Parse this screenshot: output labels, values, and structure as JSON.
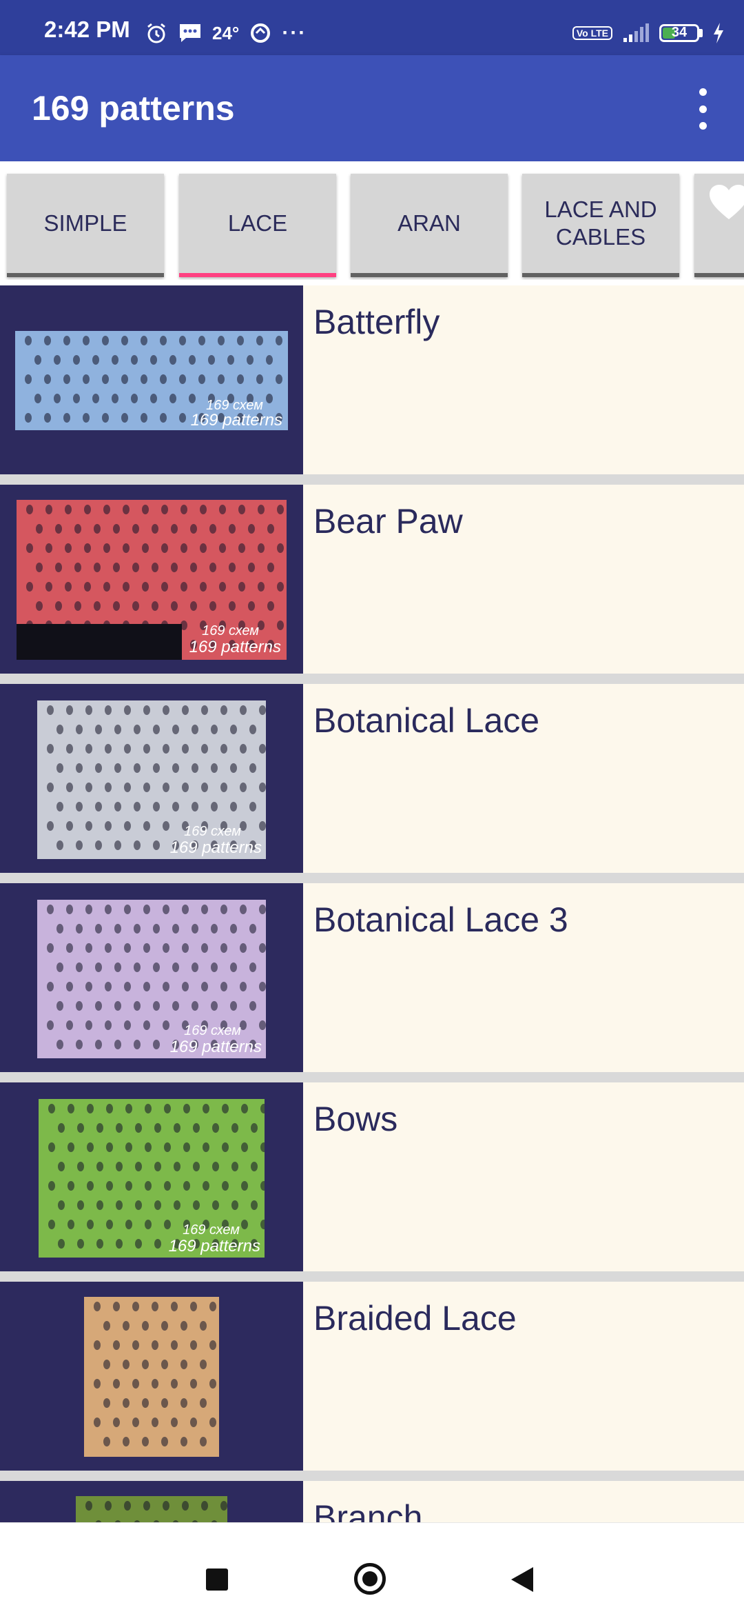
{
  "status_bar": {
    "time": "2:42 PM",
    "temperature": "24°",
    "more": "···",
    "network": "Vo LTE",
    "battery": "34"
  },
  "app_bar": {
    "title": "169 patterns",
    "overflow_icon": "more-vert-icon"
  },
  "tabs": [
    {
      "label": "SIMPLE",
      "active": false
    },
    {
      "label": "LACE",
      "active": true
    },
    {
      "label": "ARAN",
      "active": false
    },
    {
      "label": "LACE AND CABLES",
      "active": false
    },
    {
      "label": "",
      "icon": "heart-icon",
      "active": false
    }
  ],
  "patterns": [
    {
      "name": "Batterfly",
      "color": "#8fb2de"
    },
    {
      "name": "Bear Paw",
      "color": "#d5575f"
    },
    {
      "name": "Botanical Lace",
      "color": "#c9ccd6"
    },
    {
      "name": "Botanical Lace 3",
      "color": "#c8b3dc"
    },
    {
      "name": "Bows",
      "color": "#7db94a"
    },
    {
      "name": "Braided Lace",
      "color": "#d6a878"
    },
    {
      "name": "Branch",
      "color": "#6f8f3a"
    }
  ],
  "watermark": {
    "line1": "169 схем",
    "line2": "169 patterns"
  },
  "colors": {
    "status_bar": "#2f3f9b",
    "app_bar": "#3d51b7",
    "tab_indicator": "#ff4081",
    "list_bg": "#fdf8ec",
    "thumb_bg": "#2d2a5e",
    "text": "#2a2a5c"
  }
}
